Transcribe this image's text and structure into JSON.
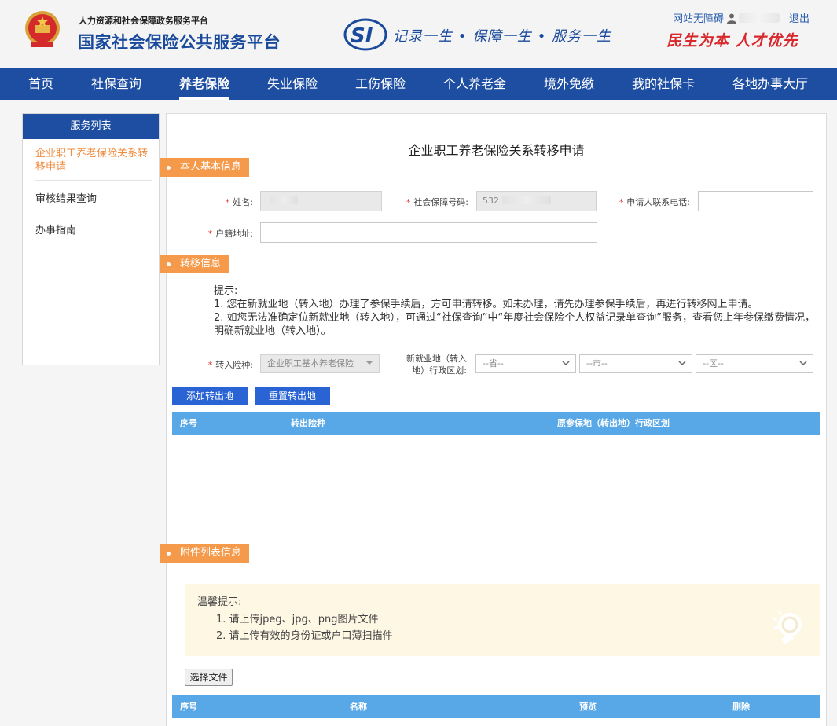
{
  "header": {
    "sub_title": "人力资源和社会保障政务服务平台",
    "title": "国家社会保险公共服务平台",
    "slogan": "记录一生 • 保障一生 • 服务一生",
    "motto": "民生为本 人才优先",
    "accessibility": "网站无障碍",
    "logout": "退出"
  },
  "nav": {
    "items": [
      "首页",
      "社保查询",
      "养老保险",
      "失业保险",
      "工伤保险",
      "个人养老金",
      "境外免缴",
      "我的社保卡",
      "各地办事大厅"
    ],
    "active": "养老保险"
  },
  "sidebar": {
    "title": "服务列表",
    "items": [
      "企业职工养老保险关系转移申请",
      "审核结果查询",
      "办事指南"
    ]
  },
  "main": {
    "title": "企业职工养老保险关系转移申请",
    "sections": {
      "basic": "本人基本信息",
      "transfer": "转移信息",
      "attachments": "附件列表信息"
    },
    "basic": {
      "name_label": "姓名:",
      "ssn_label": "社会保障号码:",
      "ssn_value_prefix": "532",
      "phone_label": "申请人联系电话:",
      "address_label": "户籍地址:"
    },
    "tips": {
      "head": "提示:",
      "line1": "1. 您在新就业地（转入地）办理了参保手续后，方可申请转移。如未办理，请先办理参保手续后，再进行转移网上申请。",
      "line2": "2. 如您无法准确定位新就业地（转入地），可通过“社保查询”中“年度社会保险个人权益记录单查询”服务，查看您上年参保缴费情况，明确新就业地（转入地）。"
    },
    "transfer": {
      "type_label": "转入险种:",
      "type_value": "企业职工基本养老保险",
      "region_label_1": "新就业地（转入",
      "region_label_2": "地）行政区划:",
      "province_placeholder": "--省--",
      "city_placeholder": "--市--",
      "district_placeholder": "--区--",
      "add_button": "添加转出地",
      "reset_button": "重置转出地",
      "table_headers": [
        "序号",
        "转出险种",
        "原参保地（转出地）行政区划"
      ]
    },
    "attachments": {
      "notice_head": "温馨提示:",
      "notice_items": [
        "1. 请上传jpeg、jpg、png图片文件",
        "2. 请上传有效的身份证或户口薄扫描件"
      ],
      "choose_file": "选择文件",
      "table_headers": [
        "序号",
        "名称",
        "预览",
        "删除"
      ]
    }
  }
}
